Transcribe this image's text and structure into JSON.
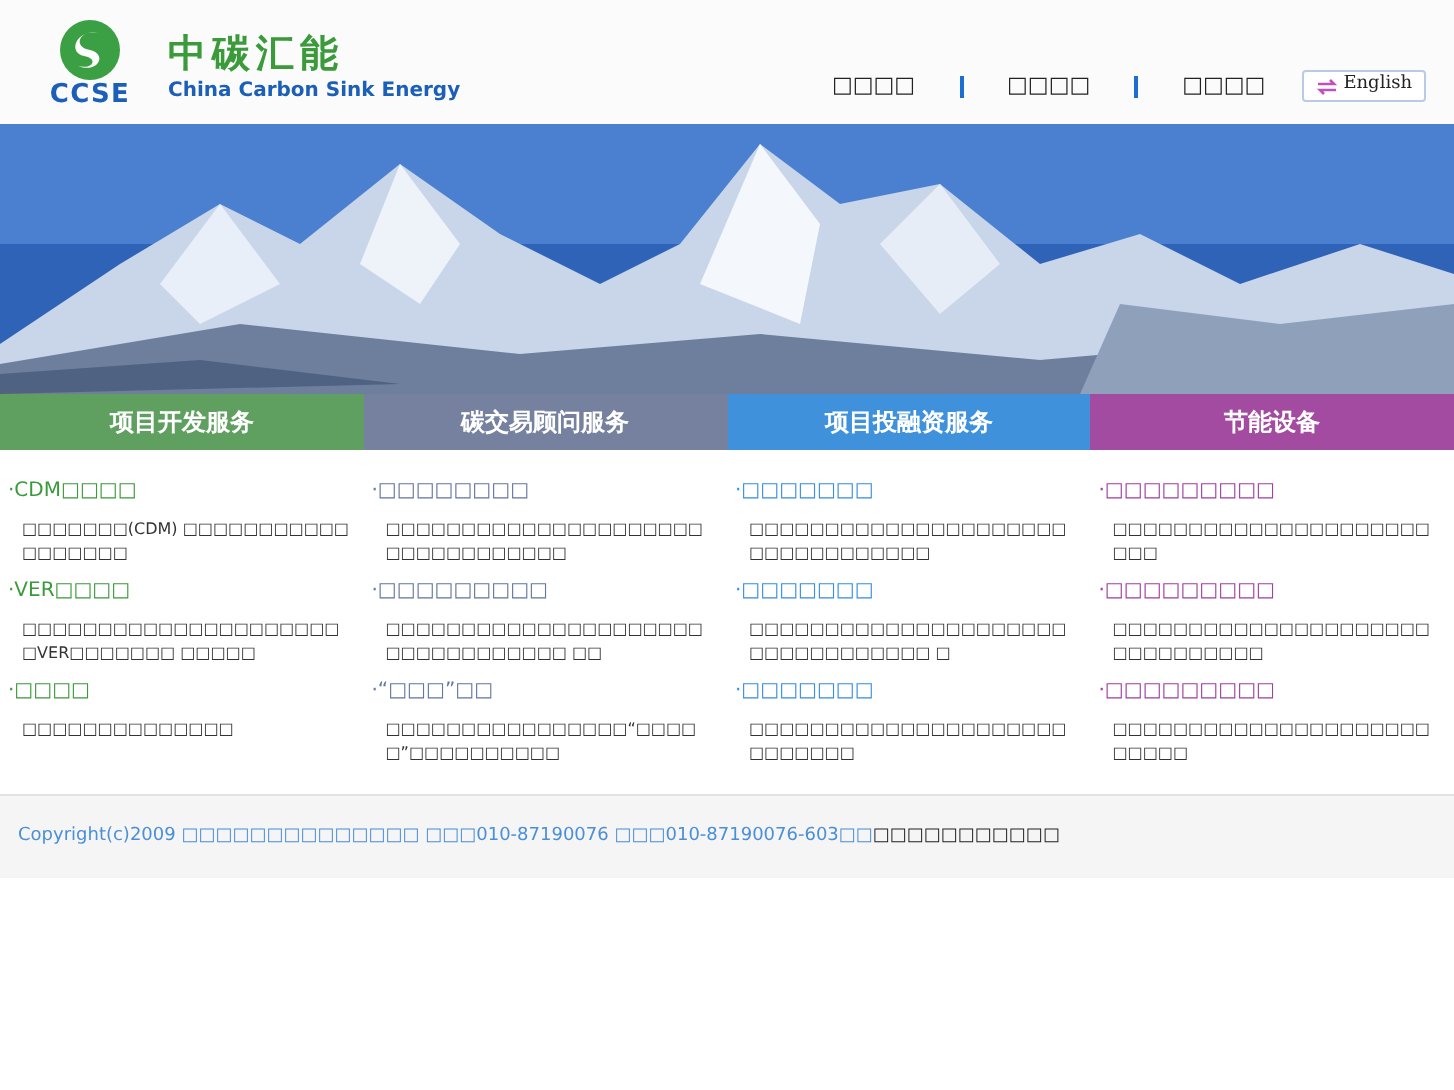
{
  "header": {
    "logo_mark": "CCSE",
    "logo_title": "中碳汇能",
    "logo_subtitle": "China Carbon Sink Energy",
    "nav": [
      "□□□□",
      "□□□□",
      "□□□□"
    ],
    "language_button": "English"
  },
  "sections": [
    {
      "tab": "项目开发服务",
      "color": "#3c9a3c",
      "items": [
        {
          "heading": "·CDM□□□□",
          "text": "□□□□□□□(CDM) □□□□□□□□□□□□□□□□□□"
        },
        {
          "heading": "·VER□□□□",
          "text": "□□□□□□□□□□□□□□□□□□□□□□VER□□□□□□□ □□□□□"
        },
        {
          "heading": "·□□□□",
          "text": "□□□□□□□□□□□□□□"
        }
      ]
    },
    {
      "tab": "碳交易顾问服务",
      "color": "#6577a0",
      "items": [
        {
          "heading": "·□□□□□□□□",
          "text": "□□□□□□□□□□□□□□□□□□□□□□□□□□□□□□□□□"
        },
        {
          "heading": "·□□□□□□□□□",
          "text": "□□□□□□□□□□□□□□□□□□□□□□□□□□□□□□□□□ □□"
        },
        {
          "heading": "·“□□□”□□",
          "text": "□□□□□□□□□□□□□□□□“□□□□□”□□□□□□□□□□"
        }
      ]
    },
    {
      "tab": "项目投融资服务",
      "color": "#3a8fe0",
      "items": [
        {
          "heading": "·□□□□□□□",
          "text": "□□□□□□□□□□□□□□□□□□□□□□□□□□□□□□□□□"
        },
        {
          "heading": "·□□□□□□□",
          "text": "□□□□□□□□□□□□□□□□□□□□□□□□□□□□□□□□□ □"
        },
        {
          "heading": "·□□□□□□□",
          "text": "□□□□□□□□□□□□□□□□□□□□□□□□□□□□"
        }
      ]
    },
    {
      "tab": "节能设备",
      "color": "#a040a0",
      "items": [
        {
          "heading": "·□□□□□□□□□",
          "text": "□□□□□□□□□□□□□□□□□□□□□□□□"
        },
        {
          "heading": "·□□□□□□□□□",
          "text": "□□□□□□□□□□□□□□□□□□□□□□□□□□□□□□□"
        },
        {
          "heading": "·□□□□□□□□□",
          "text": "□□□□□□□□□□□□□□□□□□□□□□□□□□"
        }
      ]
    }
  ],
  "footer": {
    "copyright": "Copyright(c)2009 □□□□□□□□□□□□□□ □□□010-87190076 □□□010-87190076-603□□",
    "note": "□□□□□□□□□□□"
  }
}
